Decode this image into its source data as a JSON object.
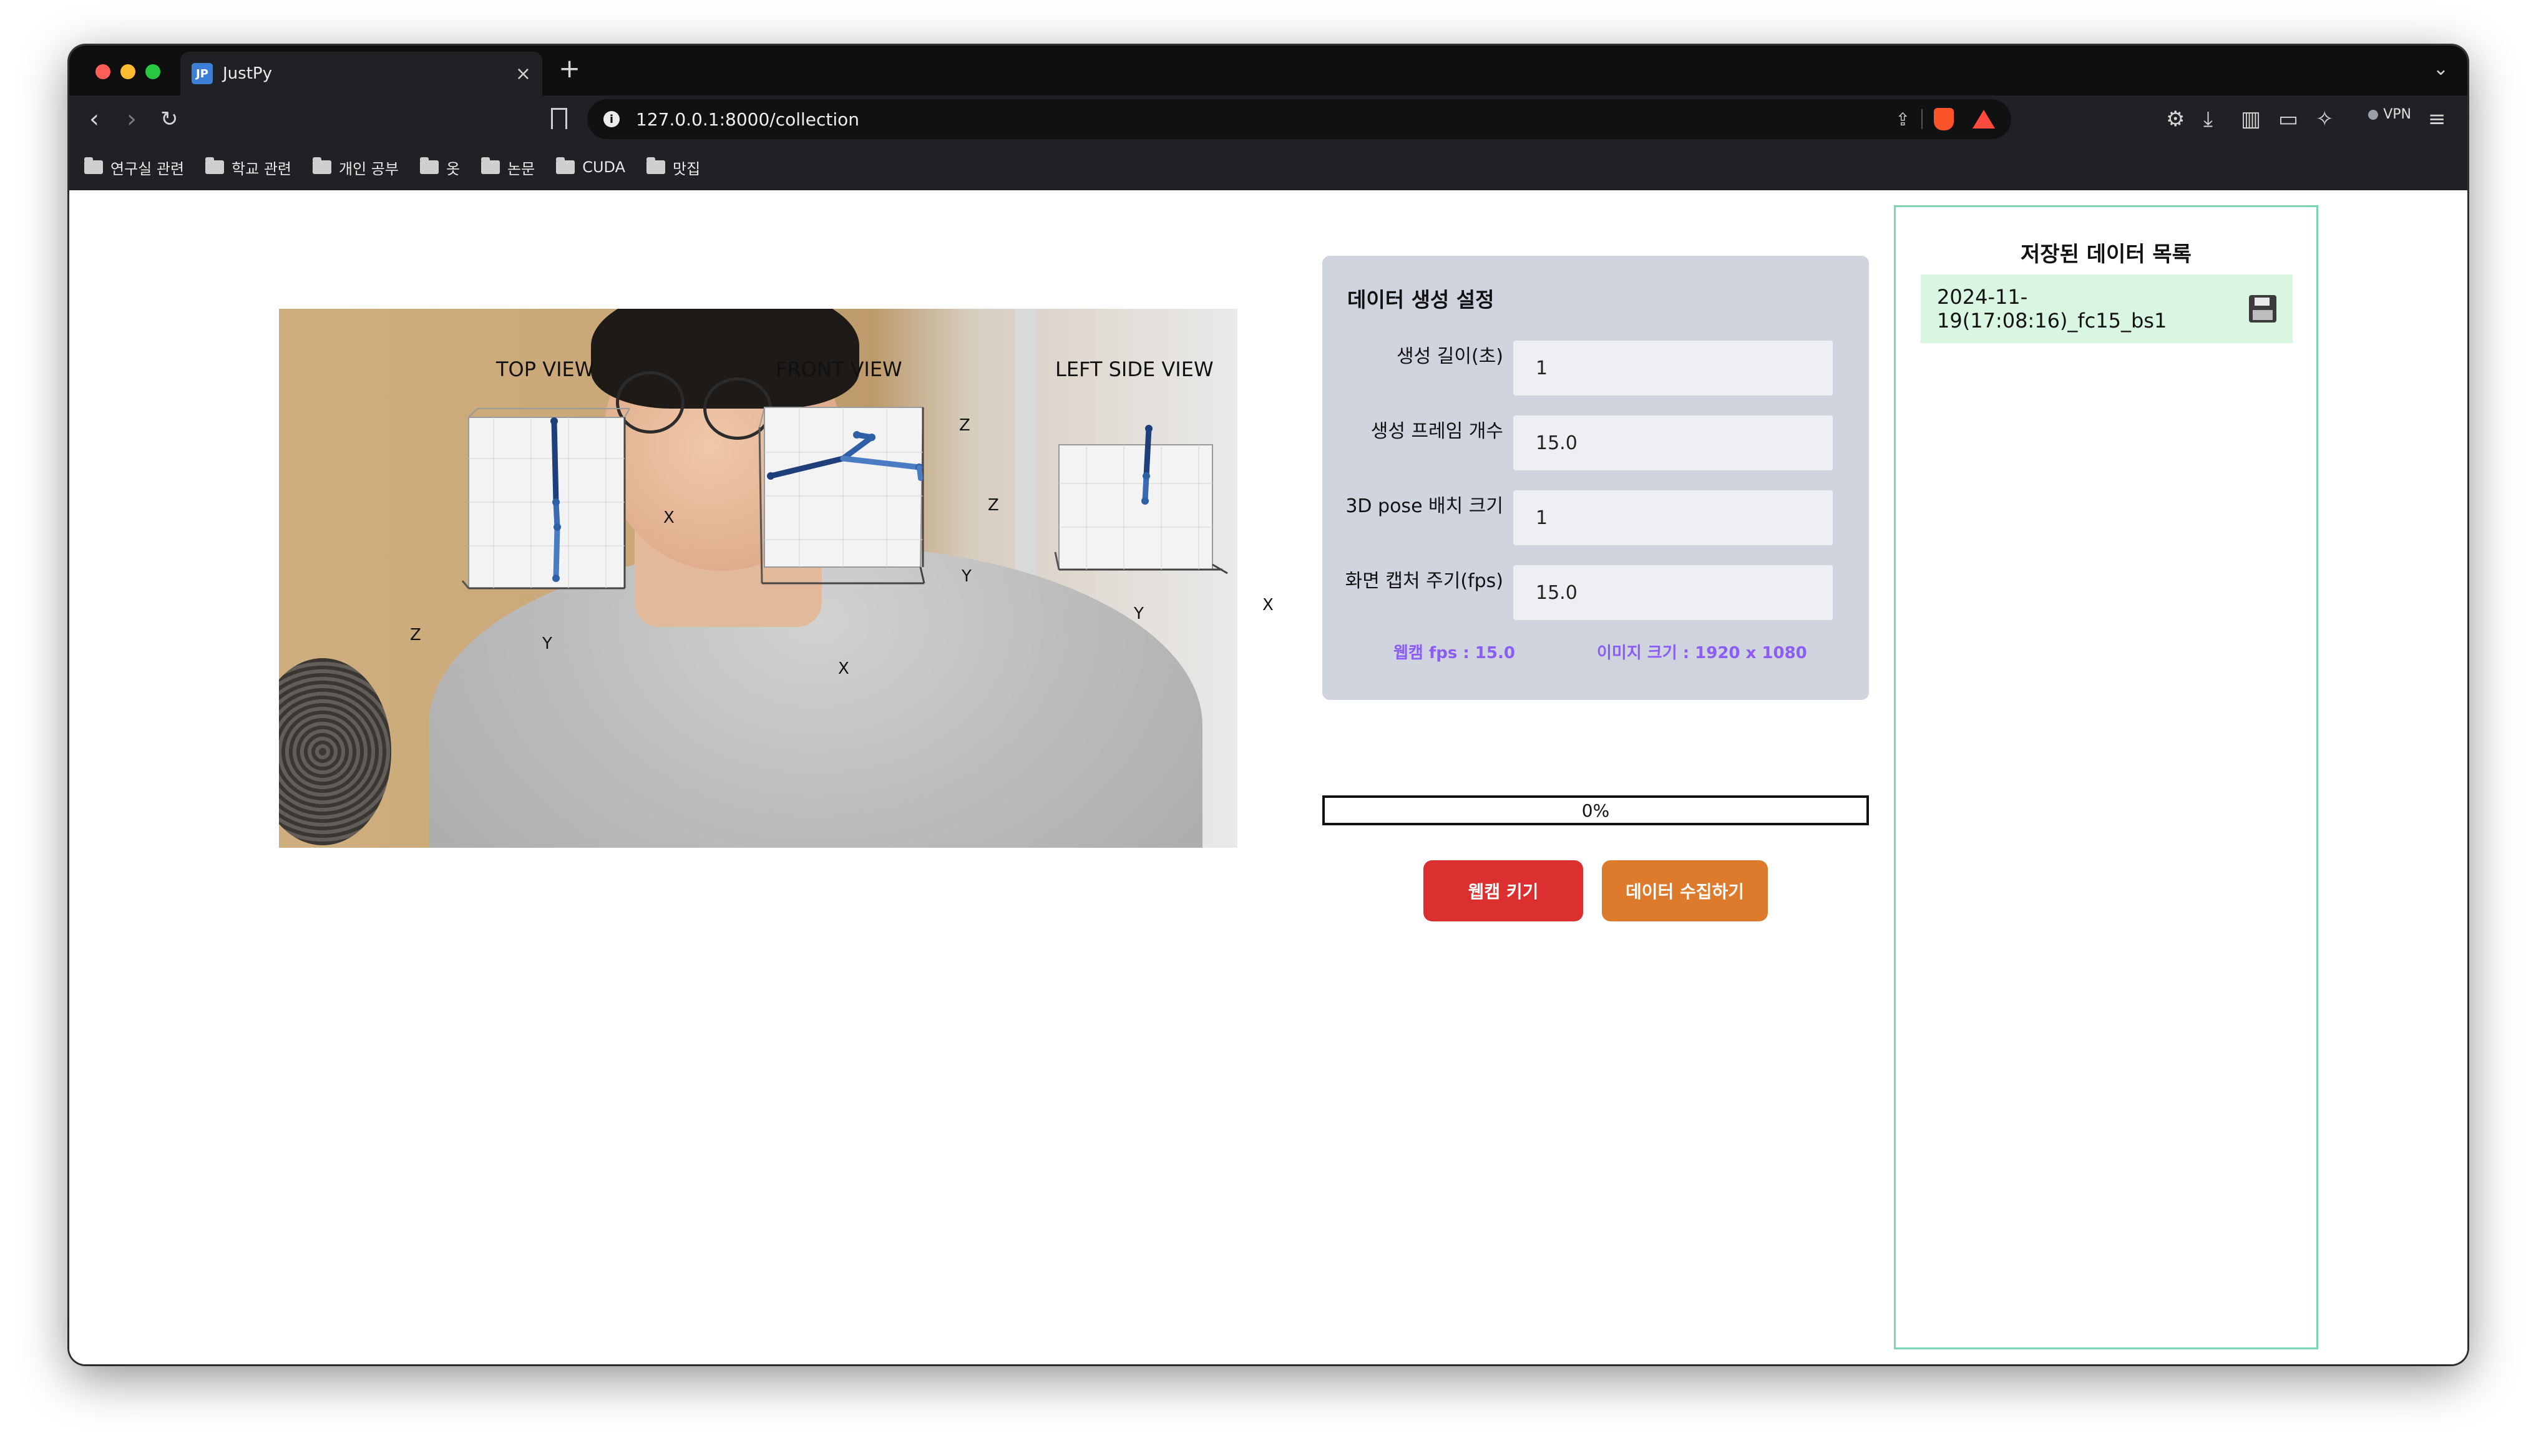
{
  "browser": {
    "tab_title": "JustPy",
    "tab_favicon": "JP",
    "url": "127.0.0.1:8000/collection",
    "bookmarks": [
      "연구실 관련",
      "학교 관련",
      "개인 공부",
      "옷",
      "논문",
      "CUDA",
      "맛집"
    ],
    "vpn_label": "VPN"
  },
  "views": {
    "top": {
      "title": "TOP VIEW",
      "x_axis": "X",
      "y_axis": "Y",
      "z_axis": "Z"
    },
    "front": {
      "title": "FRONT VIEW",
      "x_axis": "X",
      "y_axis": "Y",
      "z_axis": "Z",
      "z_axis_2": "Z"
    },
    "left": {
      "title": "LEFT SIDE VIEW",
      "x_axis": "X",
      "y_axis": "Y"
    }
  },
  "settings": {
    "title": "데이터 생성 설정",
    "fields": [
      {
        "label": "생성 길이(초)",
        "value": "1"
      },
      {
        "label": "생성 프레임 개수",
        "value": "15.0"
      },
      {
        "label": "3D pose 배치 크기",
        "value": "1"
      },
      {
        "label": "화면 캡처 주기(fps)",
        "value": "15.0"
      }
    ],
    "webcam_fps": "웹캠 fps : 15.0",
    "image_size": "이미지 크기 : 1920 x 1080"
  },
  "progress": {
    "label": "0%",
    "value": 0
  },
  "buttons": {
    "webcam": "웹캠 키기",
    "collect": "데이터 수집하기"
  },
  "saved": {
    "title": "저장된 데이터 목록",
    "items": [
      "2024-11-19(17:08:16)_fc15_bs1"
    ]
  },
  "colors": {
    "accent_purple": "#8b5cf6",
    "webcam_button": "#dc2f2f",
    "collect_button": "#dd7a2c",
    "saved_border": "#7ad6b0",
    "saved_item_bg": "#d9f6e3",
    "skeleton": "#2f5fa6"
  }
}
